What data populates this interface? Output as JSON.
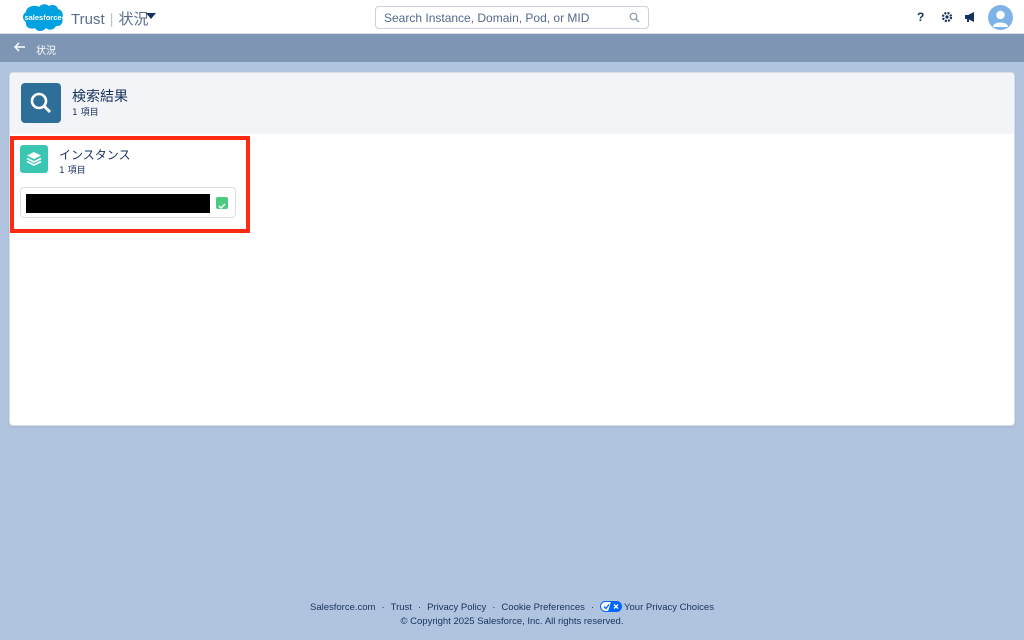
{
  "header": {
    "logo_text": "salesforce",
    "app_name": "Trust",
    "app_section": "状況",
    "search_placeholder": "Search Instance, Domain, Pod, or MID"
  },
  "subbar": {
    "back_label": "状況"
  },
  "results": {
    "title": "検索結果",
    "count": "1 項目"
  },
  "instances": {
    "title": "インスタンス",
    "count": "1 項目",
    "items": [
      {
        "name": "",
        "status": "ok"
      }
    ]
  },
  "footer": {
    "links": [
      "Salesforce.com",
      "Trust",
      "Privacy Policy",
      "Cookie Preferences",
      "Your Privacy Choices"
    ],
    "copyright": "© Copyright 2025 Salesforce, Inc. All rights reserved."
  },
  "colors": {
    "brand_blue": "#00a1e0",
    "header_icon": "#2e6f9a",
    "instance_icon": "#3bc6b3",
    "status_ok": "#4bca81",
    "highlight": "#ff2a12",
    "page_bg": "#b0c4df",
    "subbar_bg": "#7e96b3"
  }
}
